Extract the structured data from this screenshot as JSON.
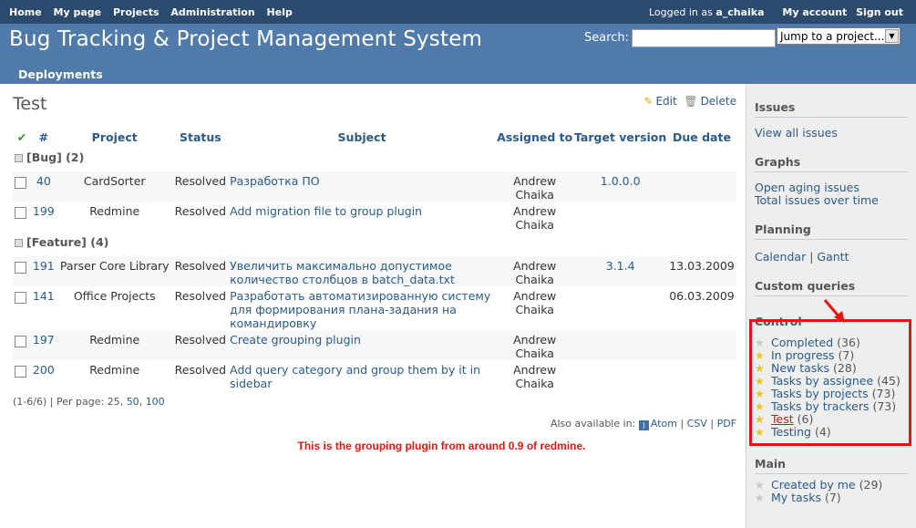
{
  "top_menu": {
    "left": [
      "Home",
      "My page",
      "Projects",
      "Administration",
      "Help"
    ],
    "logged_in_prefix": "Logged in as",
    "user": "a_chaika",
    "my_account": "My account",
    "sign_out": "Sign out"
  },
  "header": {
    "title": "Bug Tracking & Project Management System",
    "search_label": "Search:",
    "search_value": "",
    "jump_label": "Jump to a project...",
    "tab": "Deployments"
  },
  "page": {
    "title": "Test",
    "edit": "Edit",
    "delete": "Delete"
  },
  "table": {
    "columns": [
      "#",
      "Project",
      "Status",
      "Subject",
      "Assigned to",
      "Target version",
      "Due date"
    ],
    "groups": [
      {
        "label": "[Bug]",
        "count": "(2)",
        "rows": [
          {
            "id": "40",
            "project": "CardSorter",
            "status": "Resolved",
            "subject": "Разработка ПО",
            "assignee": "Andrew Chaika",
            "version": "1.0.0.0",
            "due": ""
          },
          {
            "id": "199",
            "project": "Redmine",
            "status": "Resolved",
            "subject": "Add migration file to group plugin",
            "assignee": "Andrew Chaika",
            "version": "",
            "due": ""
          }
        ]
      },
      {
        "label": "[Feature]",
        "count": "(4)",
        "rows": [
          {
            "id": "191",
            "project": "Parser Core Library",
            "status": "Resolved",
            "subject": "Увеличить максимально допустимое количество столбцов в batch_data.txt",
            "assignee": "Andrew Chaika",
            "version": "3.1.4",
            "due": "13.03.2009"
          },
          {
            "id": "141",
            "project": "Office Projects",
            "status": "Resolved",
            "subject": "Разработать автоматизированную систему для формирования плана-задания на командировку",
            "assignee": "Andrew Chaika",
            "version": "",
            "due": "06.03.2009"
          },
          {
            "id": "197",
            "project": "Redmine",
            "status": "Resolved",
            "subject": "Create grouping plugin",
            "assignee": "Andrew Chaika",
            "version": "",
            "due": ""
          },
          {
            "id": "200",
            "project": "Redmine",
            "status": "Resolved",
            "subject": "Add query category and group them by it in sidebar",
            "assignee": "Andrew Chaika",
            "version": "",
            "due": ""
          }
        ]
      }
    ]
  },
  "pagination": {
    "range": "(1-6/6)",
    "per_page_label": "| Per page:",
    "options": [
      "25",
      "50",
      "100"
    ]
  },
  "formats": {
    "label": "Also available in:",
    "items": [
      "Atom",
      "CSV",
      "PDF"
    ]
  },
  "annotation": "This is the grouping plugin from around 0.9 of redmine.",
  "sidebar": {
    "issues_heading": "Issues",
    "view_all": "View all issues",
    "graphs_heading": "Graphs",
    "graphs": [
      "Open aging issues",
      "Total issues over time"
    ],
    "planning_heading": "Planning",
    "calendar": "Calendar",
    "gantt": "Gantt",
    "custom_queries_heading": "Custom queries",
    "control_heading": "Control",
    "control_items": [
      {
        "label": "Completed",
        "count": "(36)",
        "star": "off"
      },
      {
        "label": "In progress",
        "count": "(7)",
        "star": "on"
      },
      {
        "label": "New tasks",
        "count": "(28)",
        "star": "on"
      },
      {
        "label": "Tasks by assignee",
        "count": "(45)",
        "star": "on"
      },
      {
        "label": "Tasks by projects",
        "count": "(73)",
        "star": "on"
      },
      {
        "label": "Tasks by trackers",
        "count": "(73)",
        "star": "on"
      },
      {
        "label": "Test",
        "count": "(6)",
        "star": "on",
        "active": true
      },
      {
        "label": "Testing",
        "count": "(4)",
        "star": "on"
      }
    ],
    "main_heading": "Main",
    "main_items": [
      {
        "label": "Created by me",
        "count": "(29)",
        "star": "off"
      },
      {
        "label": "My tasks",
        "count": "(7)",
        "star": "off"
      }
    ]
  },
  "colors": {
    "header_bg": "#507aaa",
    "top_menu_bg": "#2c4a6e",
    "link": "#2a5a8a",
    "annotation": "#e8140d"
  }
}
